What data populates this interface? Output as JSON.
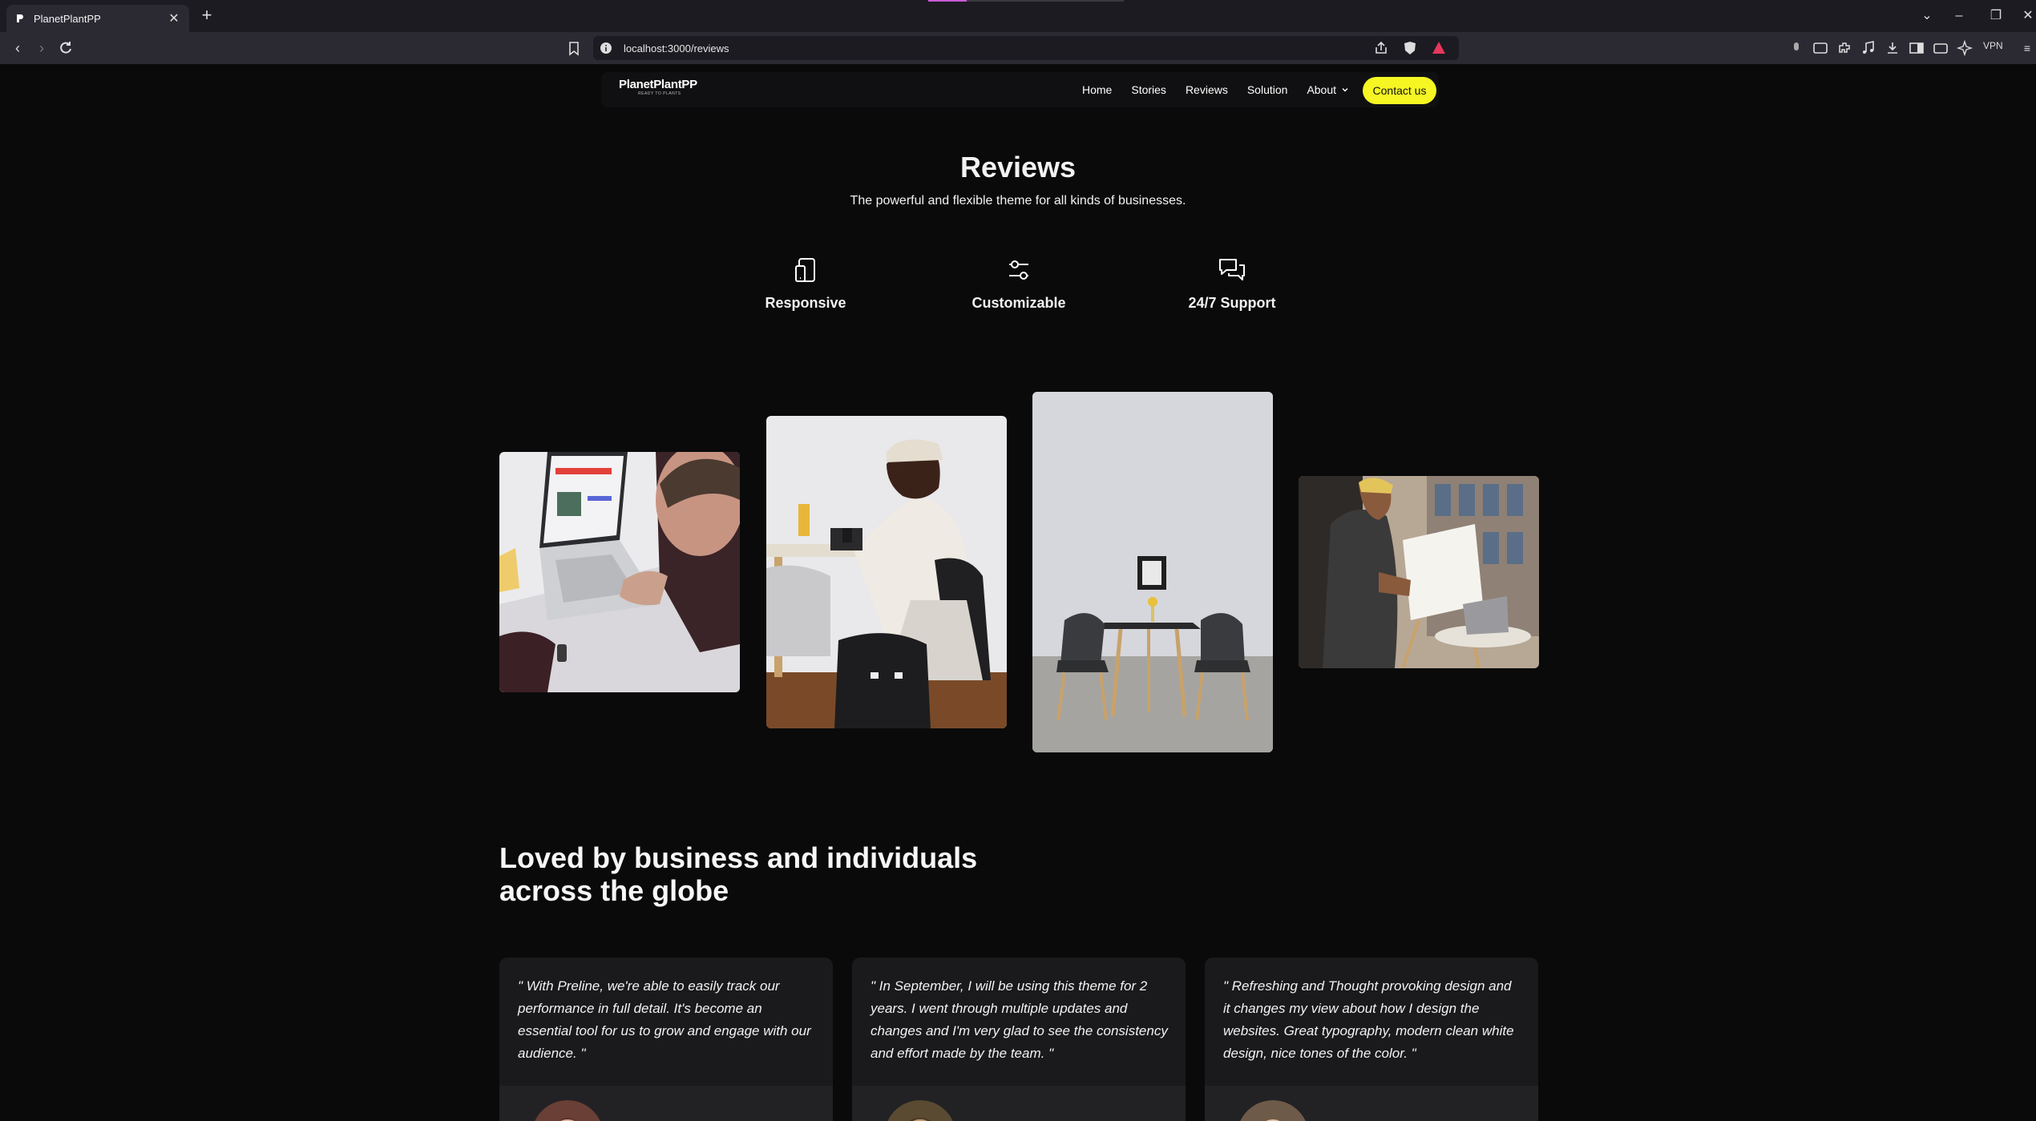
{
  "browser": {
    "tab_title": "PlanetPlantPP",
    "new_tab": "+",
    "url": "localhost:3000/reviews",
    "vpn_label": "VPN"
  },
  "header": {
    "logo_name": "PlanetPlantPP",
    "logo_tagline": "READY TO PLANTS",
    "nav": {
      "home": "Home",
      "stories": "Stories",
      "reviews": "Reviews",
      "solution": "Solution",
      "about": "About"
    },
    "contact": "Contact us",
    "accent": "#f6f623"
  },
  "hero": {
    "title": "Reviews",
    "subtitle": "The powerful and flexible theme for all kinds of businesses."
  },
  "features": [
    {
      "icon": "responsive-device-icon",
      "label": "Responsive"
    },
    {
      "icon": "sliders-icon",
      "label": "Customizable"
    },
    {
      "icon": "chat-bubbles-icon",
      "label": "24/7 Support"
    }
  ],
  "gallery": [
    {
      "name": "laptop-user-photo"
    },
    {
      "name": "man-working-at-desk-photo"
    },
    {
      "name": "dining-table-chairs-photo"
    },
    {
      "name": "man-at-easel-photo"
    }
  ],
  "loved": {
    "line1": "Loved by business and individuals",
    "line2": "across the globe"
  },
  "testimonials": [
    {
      "quote": "\" With Preline, we're able to easily track our performance in full detail. It's become an essential tool for us to grow and engage with our audience. \""
    },
    {
      "quote": "\" In September, I will be using this theme for 2 years. I went through multiple updates and changes and I'm very glad to see the consistency and effort made by the team. \""
    },
    {
      "quote": "\" Refreshing and Thought provoking design and it changes my view about how I design the websites. Great typography, modern clean white design, nice tones of the color. \""
    }
  ]
}
